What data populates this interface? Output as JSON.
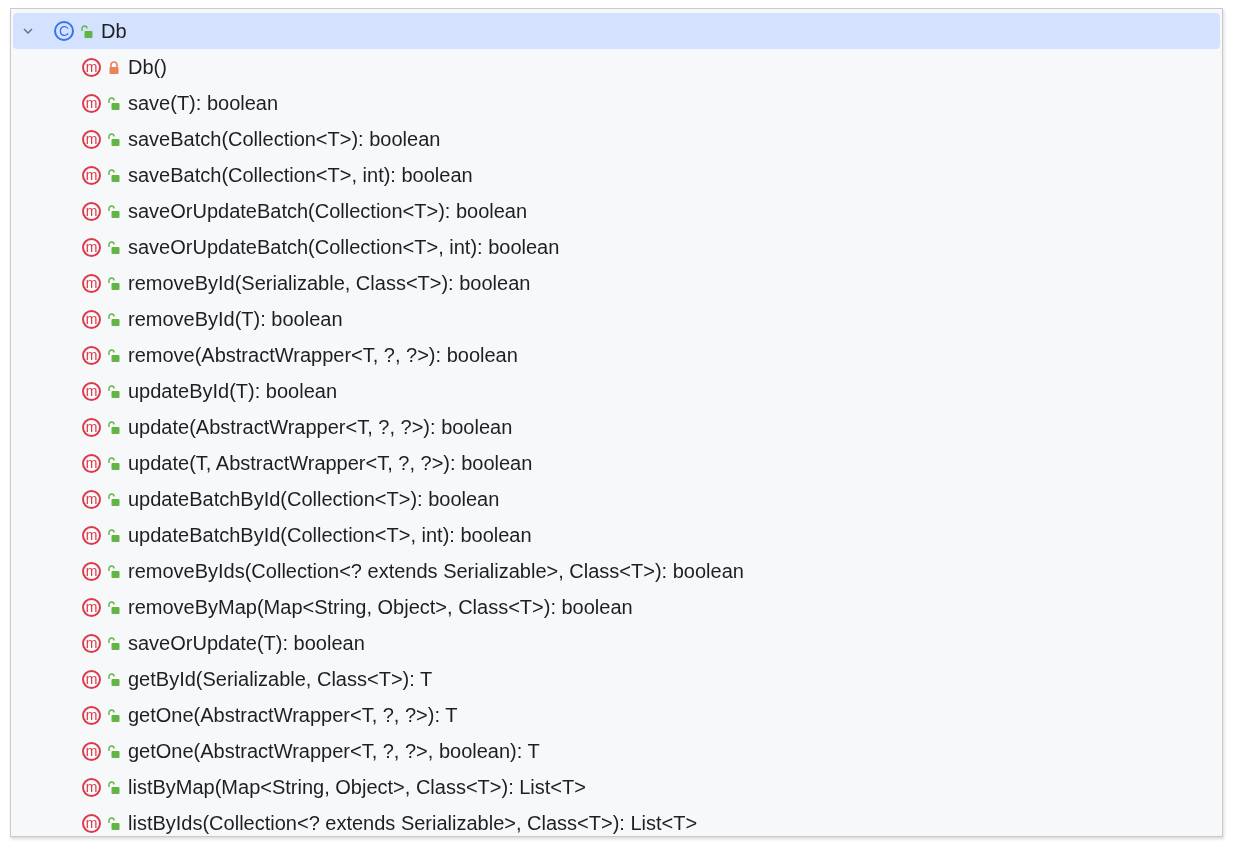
{
  "tree": [
    {
      "kind": "class",
      "badge": "C",
      "private": false,
      "label": "Db",
      "expanded": true,
      "selected": true,
      "children": [
        {
          "kind": "method",
          "badge": "m",
          "private": true,
          "label": "Db()",
          "selected": false
        },
        {
          "kind": "method",
          "badge": "m",
          "private": false,
          "label": "save(T): boolean",
          "selected": false
        },
        {
          "kind": "method",
          "badge": "m",
          "private": false,
          "label": "saveBatch(Collection<T>): boolean",
          "selected": false
        },
        {
          "kind": "method",
          "badge": "m",
          "private": false,
          "label": "saveBatch(Collection<T>, int): boolean",
          "selected": false
        },
        {
          "kind": "method",
          "badge": "m",
          "private": false,
          "label": "saveOrUpdateBatch(Collection<T>): boolean",
          "selected": false
        },
        {
          "kind": "method",
          "badge": "m",
          "private": false,
          "label": "saveOrUpdateBatch(Collection<T>, int): boolean",
          "selected": false
        },
        {
          "kind": "method",
          "badge": "m",
          "private": false,
          "label": "removeById(Serializable, Class<T>): boolean",
          "selected": false
        },
        {
          "kind": "method",
          "badge": "m",
          "private": false,
          "label": "removeById(T): boolean",
          "selected": false
        },
        {
          "kind": "method",
          "badge": "m",
          "private": false,
          "label": "remove(AbstractWrapper<T, ?, ?>): boolean",
          "selected": false
        },
        {
          "kind": "method",
          "badge": "m",
          "private": false,
          "label": "updateById(T): boolean",
          "selected": false
        },
        {
          "kind": "method",
          "badge": "m",
          "private": false,
          "label": "update(AbstractWrapper<T, ?, ?>): boolean",
          "selected": false
        },
        {
          "kind": "method",
          "badge": "m",
          "private": false,
          "label": "update(T, AbstractWrapper<T, ?, ?>): boolean",
          "selected": false
        },
        {
          "kind": "method",
          "badge": "m",
          "private": false,
          "label": "updateBatchById(Collection<T>): boolean",
          "selected": false
        },
        {
          "kind": "method",
          "badge": "m",
          "private": false,
          "label": "updateBatchById(Collection<T>, int): boolean",
          "selected": false
        },
        {
          "kind": "method",
          "badge": "m",
          "private": false,
          "label": "removeByIds(Collection<? extends Serializable>, Class<T>): boolean",
          "selected": false
        },
        {
          "kind": "method",
          "badge": "m",
          "private": false,
          "label": "removeByMap(Map<String, Object>, Class<T>): boolean",
          "selected": false
        },
        {
          "kind": "method",
          "badge": "m",
          "private": false,
          "label": "saveOrUpdate(T): boolean",
          "selected": false
        },
        {
          "kind": "method",
          "badge": "m",
          "private": false,
          "label": "getById(Serializable, Class<T>): T",
          "selected": false
        },
        {
          "kind": "method",
          "badge": "m",
          "private": false,
          "label": "getOne(AbstractWrapper<T, ?, ?>): T",
          "selected": false
        },
        {
          "kind": "method",
          "badge": "m",
          "private": false,
          "label": "getOne(AbstractWrapper<T, ?, ?>, boolean): T",
          "selected": false
        },
        {
          "kind": "method",
          "badge": "m",
          "private": false,
          "label": "listByMap(Map<String, Object>, Class<T>): List<T>",
          "selected": false
        },
        {
          "kind": "method",
          "badge": "m",
          "private": false,
          "label": "listByIds(Collection<? extends Serializable>, Class<T>): List<T>",
          "selected": false
        }
      ]
    }
  ]
}
